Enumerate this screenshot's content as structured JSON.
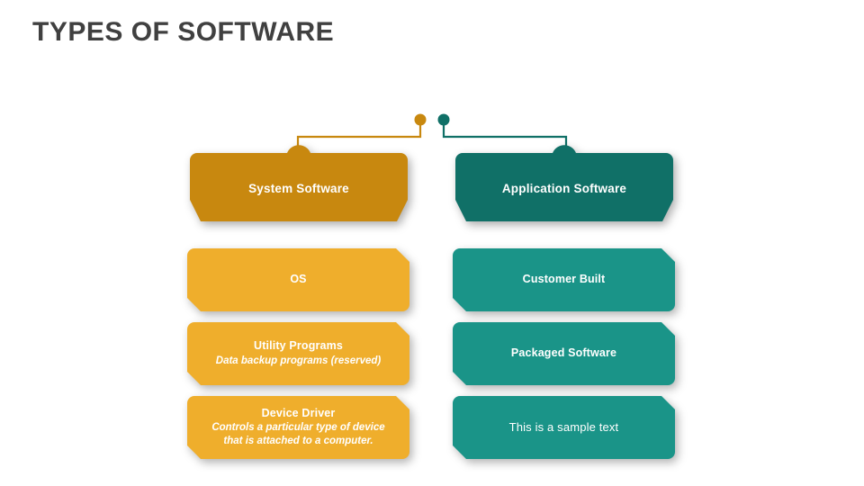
{
  "slide": {
    "title": "TYPES OF SOFTWARE",
    "background": "#FFFFFF"
  },
  "colors": {
    "title_text": "#404040",
    "root_fill": "#575757",
    "orange_dark": "#C8880F",
    "orange_light": "#EFAE2C",
    "teal_dark": "#107067",
    "teal_light": "#1A9488",
    "node_text": "#FFFFFF"
  },
  "diagram": {
    "type": "hierarchy",
    "root": {
      "label": "Types Of Software",
      "shape": "rounded-pill",
      "fill": "#575757"
    },
    "branches": [
      {
        "id": "system-software",
        "label": "System Software",
        "fill": "#C8880F",
        "connector_color": "#C8880F",
        "children": [
          {
            "title": "OS",
            "subtitle": "",
            "bold": true,
            "fill": "#EFAE2C"
          },
          {
            "title": "Utility Programs",
            "subtitle": "Data backup programs (reserved)",
            "bold": true,
            "fill": "#EFAE2C"
          },
          {
            "title": "Device Driver",
            "subtitle": "Controls a particular type of device that is attached to a computer.",
            "subtitle_line1": "Controls a particular type of device",
            "subtitle_line2": "that is attached to a computer.",
            "bold": true,
            "fill": "#EFAE2C"
          }
        ]
      },
      {
        "id": "application-software",
        "label": "Application Software",
        "fill": "#107067",
        "connector_color": "#107067",
        "children": [
          {
            "title": "Customer Built",
            "subtitle": "",
            "bold": true,
            "fill": "#1A9488"
          },
          {
            "title": "Packaged Software",
            "subtitle": "",
            "bold": true,
            "fill": "#1A9488"
          },
          {
            "title": "This is a sample text",
            "subtitle": "",
            "bold": false,
            "fill": "#1A9488"
          }
        ]
      }
    ]
  }
}
